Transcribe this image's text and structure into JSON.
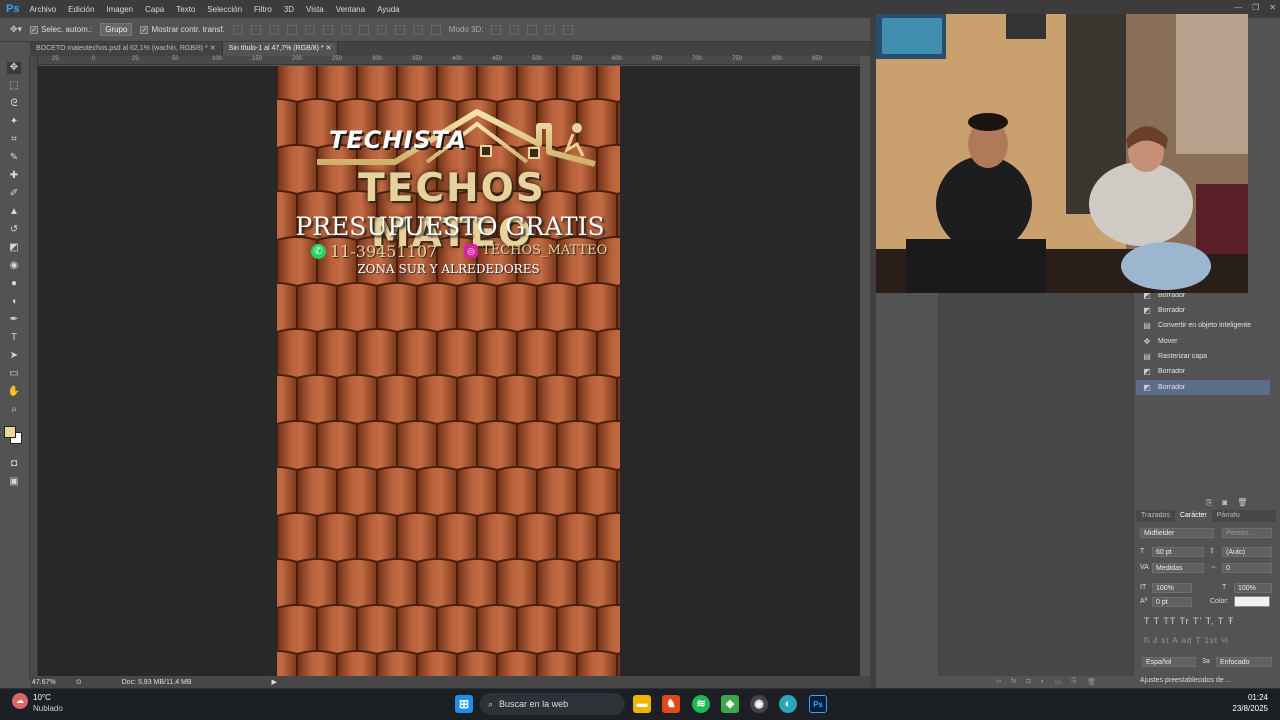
{
  "app": {
    "logo": "Ps"
  },
  "menu": [
    "Archivo",
    "Edición",
    "Imagen",
    "Capa",
    "Texto",
    "Selección",
    "Filtro",
    "3D",
    "Vista",
    "Ventana",
    "Ayuda"
  ],
  "options": {
    "auto_select_label": "Selec. autom.:",
    "auto_select_value": "Grupo",
    "show_transform": "Mostrar contr. transf.",
    "mode3d": "Modo 3D:"
  },
  "tabs": [
    {
      "label": "BOCETO mateotechos.psd al 62,1% (wachin, RGB/8) *"
    },
    {
      "label": "Sin título-1 al 47,7% (RGB/8) *"
    }
  ],
  "ruler_h": [
    "25",
    "0",
    "25",
    "50",
    "100",
    "150",
    "200",
    "250",
    "300",
    "350",
    "400",
    "450",
    "500",
    "550",
    "600",
    "650",
    "700",
    "750",
    "800",
    "850"
  ],
  "artwork": {
    "techista": "TECHISTA",
    "brand": "TECHOS MATEO",
    "headline": "PRESUPUESTO GRATIS",
    "phone": "11-39451107",
    "instagram": "TECHOS_MATTEO",
    "area": "ZONA SUR Y ALREDEDORES",
    "brand_color": "#e8d19a",
    "tile_color": "#a8532f"
  },
  "status": {
    "zoom": "47.67%",
    "doc": "Doc: 5,93 MB/11,4 MB"
  },
  "history": [
    {
      "label": "Borrador",
      "icon": "eraser-icon"
    },
    {
      "label": "Borrador",
      "icon": "eraser-icon"
    },
    {
      "label": "Convertir en objeto inteligente",
      "icon": "document-icon"
    },
    {
      "label": "Mover",
      "icon": "move-icon"
    },
    {
      "label": "Rasterizar capa",
      "icon": "document-icon"
    },
    {
      "label": "Borrador",
      "icon": "eraser-icon"
    },
    {
      "label": "Borrador",
      "icon": "eraser-icon"
    }
  ],
  "char_panel": {
    "tabs": [
      "Trazados",
      "Carácter",
      "Párrafo"
    ],
    "font": "Midfielder",
    "style": "Person...",
    "size": "60 pt",
    "leading": "(Auto)",
    "kerning": "Medidas",
    "tracking": "0",
    "vscale": "100%",
    "hscale": "100%",
    "baseline": "0 pt",
    "color_label": "Color:",
    "language": "Español",
    "aa_prefix": "3a",
    "aa": "Enfocado",
    "glyphs": "T  T  TT  Tr  T'  T,  T  Ŧ",
    "opentype": "fi  ∂  st  A  ad  T  1st  ½"
  },
  "presets": "Ajustes preestablecidos de ...",
  "taskbar": {
    "weather_temp": "10°C",
    "weather_desc": "Nublado",
    "search": "Buscar en la web",
    "time": "01:24",
    "date": "23/8/2025"
  }
}
